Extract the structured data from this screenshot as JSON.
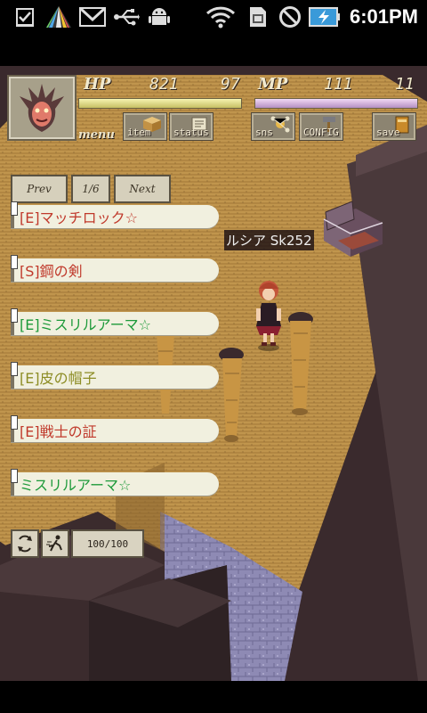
{
  "status_bar": {
    "time": "6:01PM",
    "icons": [
      "checkbox-notification-icon",
      "rainbow-triangle-icon",
      "gmail-icon",
      "usb-icon",
      "android-debug-icon",
      "wifi-icon",
      "sim-icon",
      "no-signal-icon",
      "battery-charging-icon"
    ]
  },
  "hud": {
    "hp_label": "HP",
    "hp_current": "821",
    "hp_max": "97",
    "mp_label": "MP",
    "mp_current": "111",
    "mp_max": "11",
    "menu_label": "menu",
    "buttons": [
      {
        "id": "item",
        "label": "item"
      },
      {
        "id": "status",
        "label": "status"
      },
      {
        "id": "sns",
        "label": "sns"
      },
      {
        "id": "config",
        "label": "CONFIG"
      },
      {
        "id": "save",
        "label": "save"
      }
    ]
  },
  "inventory": {
    "prev_label": "Prev",
    "page_indicator": "1/6",
    "page_current": "1",
    "page_total": "6",
    "next_label": "Next",
    "items": [
      {
        "text": "[E]マッチロック☆",
        "color": "#c0392b"
      },
      {
        "text": "[S]鋼の剣",
        "color": "#c0392b"
      },
      {
        "text": "[E]ミスリルアーマ☆",
        "color": "#1e9a3a"
      },
      {
        "text": "[E]皮の帽子",
        "color": "#8d8d25"
      },
      {
        "text": "[E]戦士の証",
        "color": "#c0392b"
      },
      {
        "text": "ミスリルアーマ☆",
        "color": "#1e9a3a"
      }
    ],
    "count_display": "100/100",
    "count_current": "100",
    "count_max": "100"
  },
  "scene": {
    "npc_label": "ルシア Sk252"
  },
  "colors": {
    "wall": "#3a2a2d",
    "wall_top": "#4b3b3d",
    "floor_wood": "#c79b4f",
    "floor_wood_dark": "#8a6530",
    "stone": "#8a86b0",
    "hud_panel": "#8c8471"
  }
}
